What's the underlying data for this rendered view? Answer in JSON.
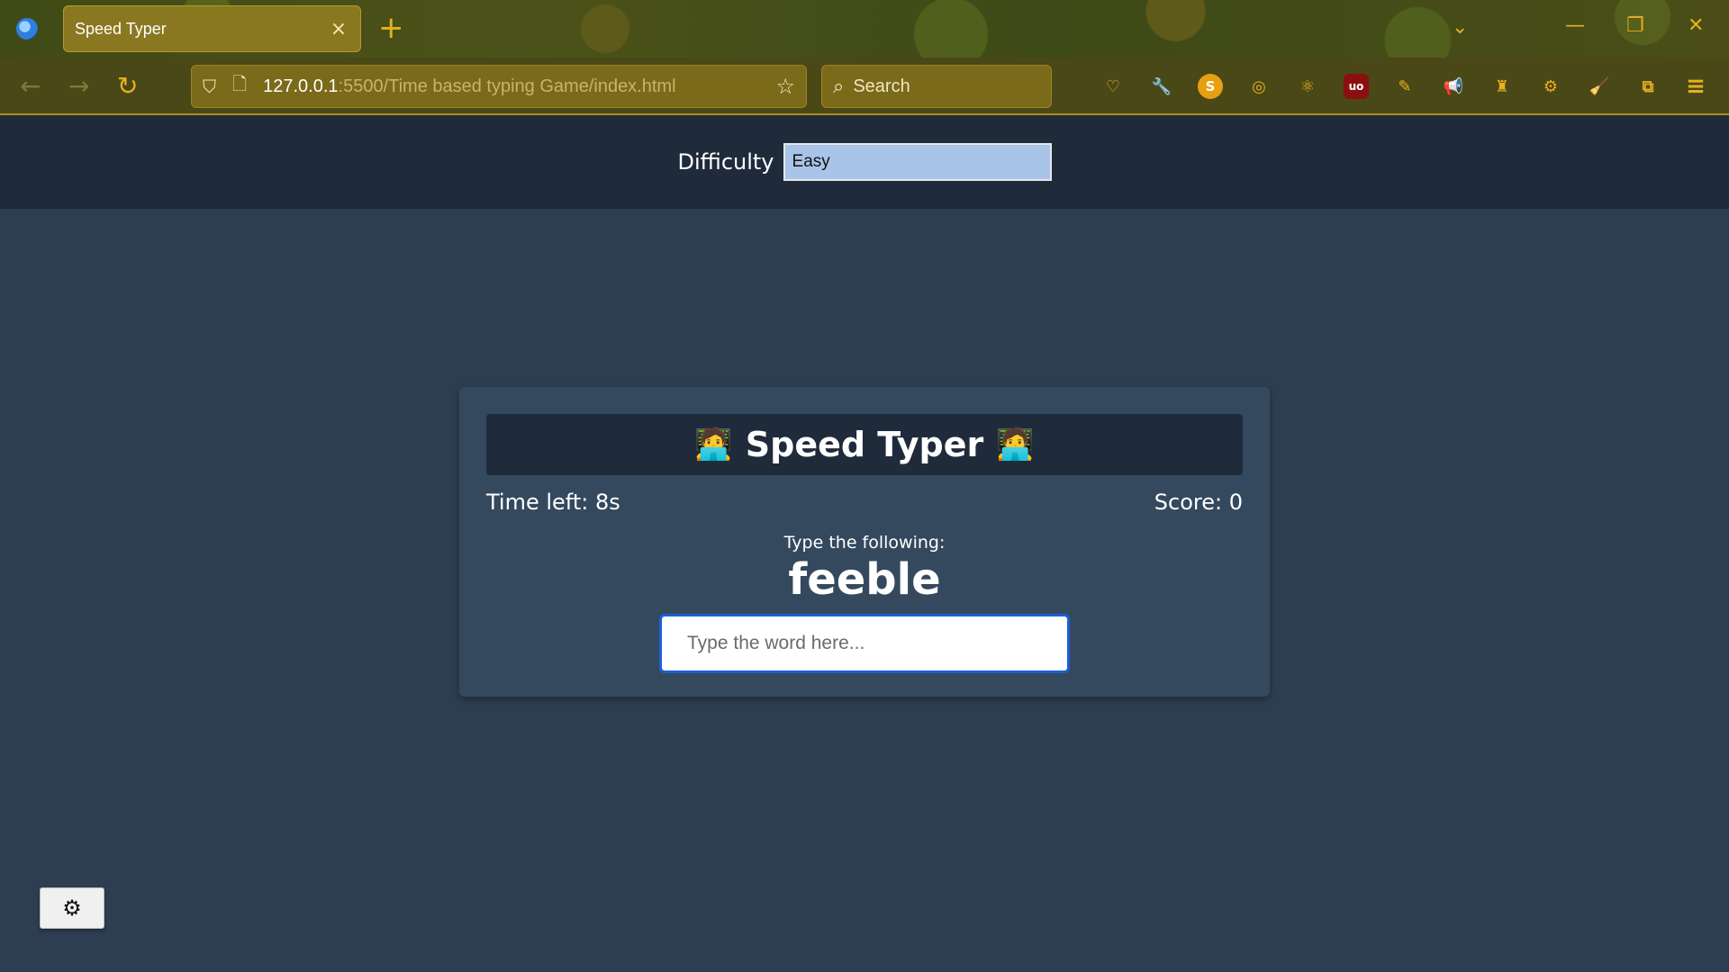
{
  "browser": {
    "tab_title": "Speed Typer",
    "tab_close": "×",
    "new_tab": "+",
    "url_host": "127.0.0.1",
    "url_path": ":5500/Time based typing Game/index.html",
    "search_placeholder": "Search",
    "icons": {
      "back": "←",
      "forward": "→",
      "reload": "↻",
      "shield": "⛉",
      "page": "🗋",
      "star": "☆",
      "search": "⌕",
      "list_tabs": "⌄",
      "minimize": "—",
      "maximize": "❐",
      "close": "✕",
      "menu": "≡"
    },
    "extensions": [
      "pocket-icon",
      "wrench-icon",
      "s-extension-icon",
      "glasses-icon",
      "react-icon",
      "ublock-icon",
      "pen-icon",
      "megaphone-icon",
      "lighthouse-icon",
      "gear-extension-icon",
      "broom-icon",
      "puzzle-icon"
    ],
    "ext_glyphs": [
      "♡",
      "🔧",
      "S",
      "◎",
      "⚛",
      "uo",
      "✎",
      "📢",
      "♜",
      "⚙",
      "🧹",
      "⧉"
    ]
  },
  "settings": {
    "difficulty_label": "Difficulty",
    "difficulty_value": "Easy"
  },
  "game": {
    "emoji_left": "🧑‍💻",
    "title": "Speed Typer",
    "emoji_right": "🧑‍💻",
    "time_left": "Time left: 8s",
    "score": "Score: 0",
    "prompt": "Type the following:",
    "word": "feeble",
    "input_placeholder": "Type the word here...",
    "input_value": ""
  },
  "settings_button_icon": "⚙",
  "colors": {
    "page_bg": "#2d3e52",
    "settings_bar_bg": "#1f2b3b",
    "card_bg": "#34495e",
    "input_focus": "#1a5fd6",
    "select_bg": "#a8c4e8",
    "browser_accent": "#e6b020"
  }
}
